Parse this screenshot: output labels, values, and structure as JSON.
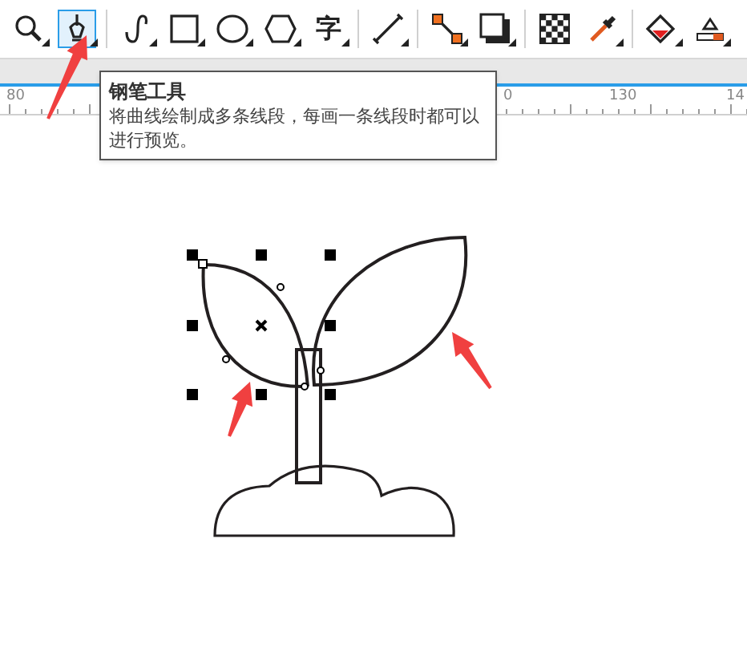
{
  "toolbar": {
    "tools": [
      {
        "kind": "zoom",
        "selected": false
      },
      {
        "kind": "pen",
        "selected": true
      },
      {
        "kind": "curve",
        "selected": false
      },
      {
        "kind": "rectangle",
        "selected": false
      },
      {
        "kind": "ellipse",
        "selected": false
      },
      {
        "kind": "polygon",
        "selected": false
      },
      {
        "kind": "text",
        "label": "字",
        "selected": false
      },
      {
        "kind": "dimension",
        "selected": false
      },
      {
        "kind": "connector",
        "selected": false
      },
      {
        "kind": "shadow",
        "selected": false
      },
      {
        "kind": "transparency",
        "selected": false
      },
      {
        "kind": "eyedropper",
        "selected": false
      },
      {
        "kind": "fill",
        "selected": false
      },
      {
        "kind": "outline",
        "selected": false
      }
    ]
  },
  "ruler": {
    "labels": [
      "80",
      "0",
      "130",
      "14"
    ]
  },
  "tooltip": {
    "title": "钢笔工具",
    "text": "将曲线绘制成多条线段，每画一条线段时都可以进行预览。"
  }
}
